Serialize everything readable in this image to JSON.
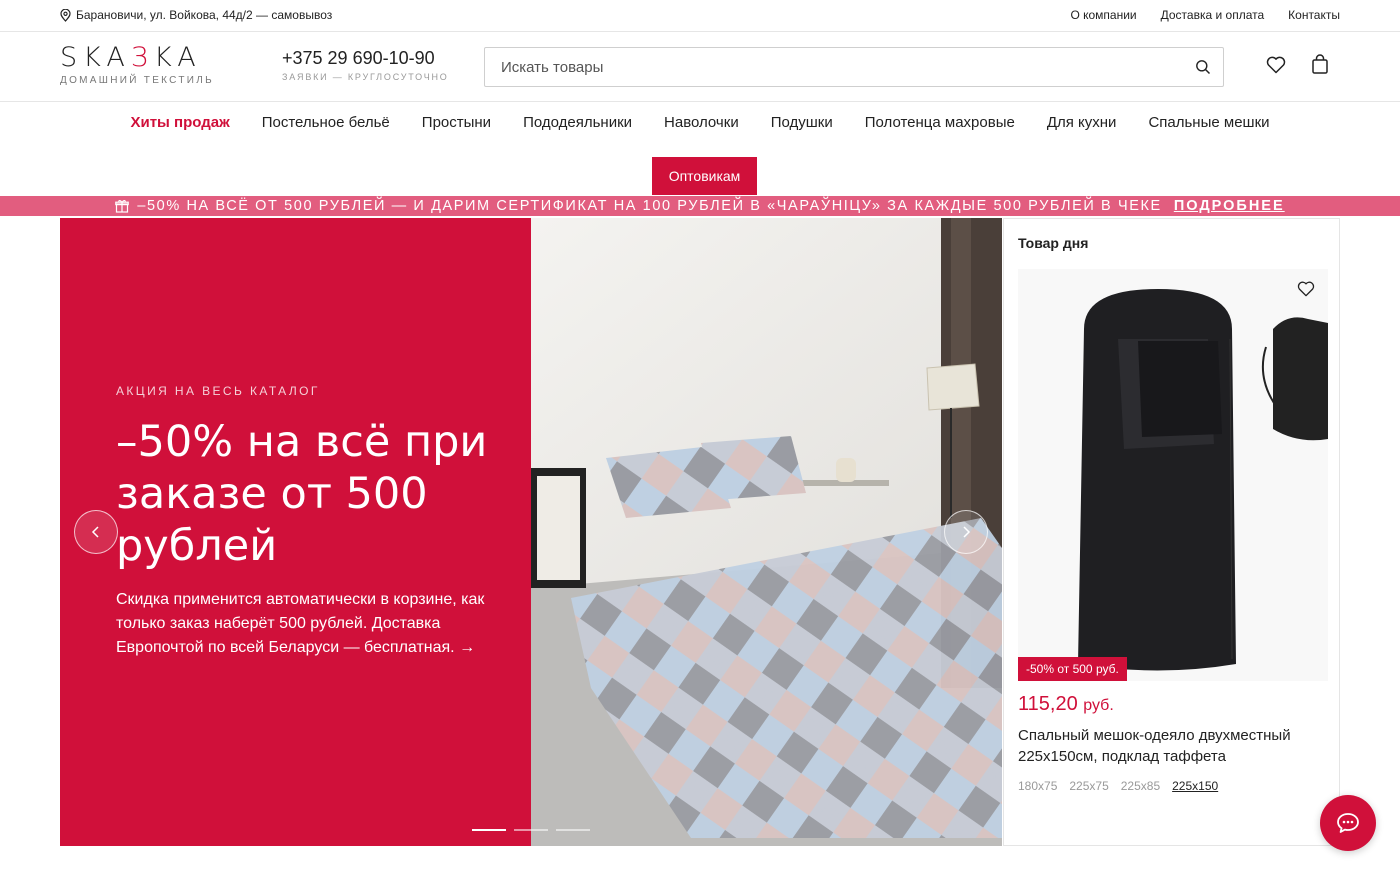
{
  "topbar": {
    "location": "Барановичи, ул. Войкова, 44д/2 — самовывоз",
    "links": [
      "О компании",
      "Доставка и оплата",
      "Контакты"
    ]
  },
  "header": {
    "logo_prefix": "SKA",
    "logo_accent": "З",
    "logo_suffix": "KA",
    "logo_tagline": "ДОМАШНИЙ ТЕКСТИЛЬ",
    "phone": "+375 29 690-10-90",
    "phone_note": "ЗАЯВКИ — КРУГЛОСУТОЧНО",
    "search_placeholder": "Искать товары"
  },
  "nav": {
    "items": [
      "Хиты продаж",
      "Постельное бельё",
      "Простыни",
      "Пододеяльники",
      "Наволочки",
      "Подушки",
      "Полотенца махровые",
      "Для кухни",
      "Спальные мешки"
    ],
    "wholesale": "Оптовикам"
  },
  "promo": {
    "text": "–50% НА ВСЁ ОТ 500 РУБЛЕЙ — И ДАРИМ СЕРТИФИКАТ НА 100 РУБЛЕЙ В «ЧАРАЎНІЦУ» ЗА КАЖДЫЕ 500 РУБЛЕЙ В ЧЕКЕ",
    "more": "ПОДРОБНЕЕ"
  },
  "hero": {
    "eyebrow": "АКЦИЯ НА ВЕСЬ КАТАЛОГ",
    "headline": "–50% на всё при заказе от 500 рублей",
    "description": "Скидка применится автоматически в корзине, как только заказ наберёт 500 рублей. Доставка Европочтой по всей Беларуси — бесплатная. →",
    "slide_count": 3,
    "active_slide": 1
  },
  "deal": {
    "title": "Товар дня",
    "badge": "-50% от 500 руб.",
    "price": "115,20",
    "currency": "руб.",
    "name": "Спальный мешок-одеяло двухместный 225х150см, подклад таффета",
    "sizes": [
      "180х75",
      "225х75",
      "225х85",
      "225х150"
    ],
    "selected_size": "225х150"
  },
  "colors": {
    "accent": "#d0103a",
    "promo": "#e25d7f"
  }
}
